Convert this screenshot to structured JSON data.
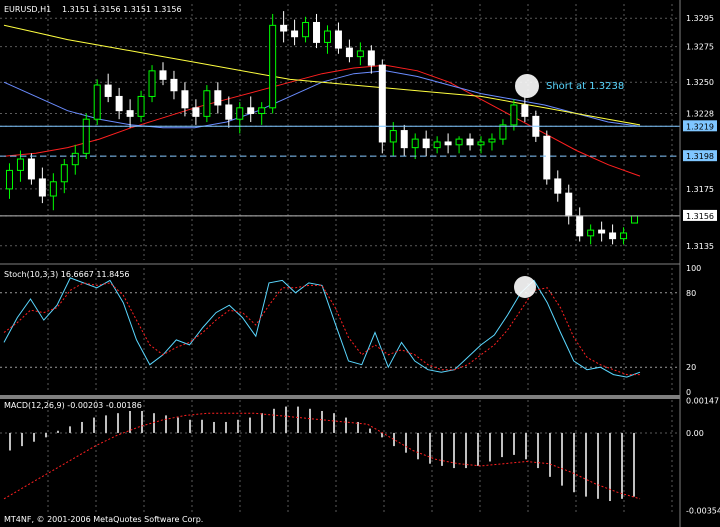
{
  "header": {
    "symbol": "EURUSD,H1",
    "ohlc": "1.3151 1.3156 1.3151 1.3156"
  },
  "annotation": {
    "text": "Short at 1.3238"
  },
  "stoch_header": "Stoch(10,3,3) 16.6667 11.8456",
  "macd_header": "MACD(12,26,9) -0.00203 -0.00186",
  "footer": "MT4NF, © 2001-2006 MetaQuotes Software Corp.",
  "colors": {
    "background": "#000000",
    "bull_candle": "#00ff00",
    "bear_candle": "#ffffff",
    "ma_fast": "#ff2020",
    "ma_mid": "#6a8cff",
    "ma_slow": "#ffff40",
    "stoch_main": "#5ad7ff",
    "stoch_signal": "#ff2020",
    "macd_hist": "#c0c0c0",
    "macd_signal": "#ff2020",
    "h_line_1": "#7fc6ff",
    "h_line_2": "#7fc6ff",
    "highlight": "#ffffff",
    "annotation_text": "#5ad7ff"
  },
  "chart_data": [
    {
      "type": "candlestick",
      "symbol": "EURUSD",
      "timeframe": "H1",
      "ylim": [
        1.3125,
        1.3305
      ],
      "y_ticks": [
        "1.3295",
        "1.3275",
        "1.3250",
        "1.3228",
        "1.3219",
        "1.3198",
        "1.3175",
        "1.3156",
        "1.3135"
      ],
      "highlighted_price_labels": [
        "1.3219",
        "1.3198",
        "1.3156"
      ],
      "h_lines": [
        1.3219,
        1.3198,
        1.3156
      ],
      "candles": [
        [
          1.3175,
          1.3193,
          1.3168,
          1.3188
        ],
        [
          1.3188,
          1.3202,
          1.318,
          1.3196
        ],
        [
          1.3196,
          1.32,
          1.3178,
          1.3182
        ],
        [
          1.3182,
          1.319,
          1.3165,
          1.317
        ],
        [
          1.317,
          1.3186,
          1.316,
          1.318
        ],
        [
          1.318,
          1.3196,
          1.3172,
          1.3192
        ],
        [
          1.3192,
          1.3206,
          1.3185,
          1.32
        ],
        [
          1.32,
          1.3228,
          1.3196,
          1.3224
        ],
        [
          1.3224,
          1.3252,
          1.322,
          1.3248
        ],
        [
          1.3248,
          1.3256,
          1.3236,
          1.324
        ],
        [
          1.324,
          1.3246,
          1.3224,
          1.323
        ],
        [
          1.323,
          1.3238,
          1.3218,
          1.3226
        ],
        [
          1.3226,
          1.3244,
          1.3222,
          1.324
        ],
        [
          1.324,
          1.3262,
          1.3236,
          1.3258
        ],
        [
          1.3258,
          1.3264,
          1.3248,
          1.3252
        ],
        [
          1.3252,
          1.3258,
          1.3238,
          1.3244
        ],
        [
          1.3244,
          1.325,
          1.3226,
          1.3232
        ],
        [
          1.3232,
          1.3238,
          1.322,
          1.3226
        ],
        [
          1.3226,
          1.3248,
          1.3222,
          1.3244
        ],
        [
          1.3244,
          1.325,
          1.3228,
          1.3234
        ],
        [
          1.3234,
          1.324,
          1.3218,
          1.3224
        ],
        [
          1.3224,
          1.3236,
          1.3214,
          1.3232
        ],
        [
          1.3232,
          1.324,
          1.3222,
          1.3228
        ],
        [
          1.3228,
          1.3236,
          1.322,
          1.3232
        ],
        [
          1.3232,
          1.3298,
          1.3228,
          1.329
        ],
        [
          1.329,
          1.33,
          1.3278,
          1.3286
        ],
        [
          1.3286,
          1.3294,
          1.3276,
          1.3282
        ],
        [
          1.3282,
          1.3296,
          1.3278,
          1.3292
        ],
        [
          1.3292,
          1.3298,
          1.3274,
          1.3278
        ],
        [
          1.3278,
          1.329,
          1.327,
          1.3286
        ],
        [
          1.3286,
          1.3292,
          1.327,
          1.3274
        ],
        [
          1.3274,
          1.328,
          1.3264,
          1.3268
        ],
        [
          1.3268,
          1.3278,
          1.3262,
          1.3272
        ],
        [
          1.3272,
          1.3276,
          1.3256,
          1.3262
        ],
        [
          1.3262,
          1.3266,
          1.32,
          1.3208
        ],
        [
          1.3208,
          1.3222,
          1.3198,
          1.3216
        ],
        [
          1.3216,
          1.322,
          1.3198,
          1.3204
        ],
        [
          1.3204,
          1.3214,
          1.3196,
          1.321
        ],
        [
          1.321,
          1.3216,
          1.3198,
          1.3204
        ],
        [
          1.3204,
          1.3212,
          1.32,
          1.3208
        ],
        [
          1.3208,
          1.3214,
          1.32,
          1.3206
        ],
        [
          1.3206,
          1.3212,
          1.32,
          1.321
        ],
        [
          1.321,
          1.3214,
          1.3202,
          1.3206
        ],
        [
          1.3206,
          1.3212,
          1.32,
          1.3208
        ],
        [
          1.3208,
          1.3214,
          1.3202,
          1.321
        ],
        [
          1.321,
          1.3224,
          1.3206,
          1.322
        ],
        [
          1.322,
          1.3238,
          1.3216,
          1.3234
        ],
        [
          1.3234,
          1.324,
          1.3222,
          1.3226
        ],
        [
          1.3226,
          1.323,
          1.3208,
          1.3212
        ],
        [
          1.3212,
          1.3216,
          1.3178,
          1.3182
        ],
        [
          1.3182,
          1.3188,
          1.3166,
          1.3172
        ],
        [
          1.3172,
          1.3178,
          1.315,
          1.3156
        ],
        [
          1.3156,
          1.3162,
          1.3138,
          1.3142
        ],
        [
          1.3142,
          1.315,
          1.3136,
          1.3146
        ],
        [
          1.3146,
          1.3152,
          1.3138,
          1.3144
        ],
        [
          1.3144,
          1.315,
          1.3136,
          1.314
        ],
        [
          1.314,
          1.3148,
          1.3136,
          1.3144
        ],
        [
          1.3151,
          1.3156,
          1.3151,
          1.3156
        ]
      ],
      "ma_series": [
        {
          "values": [
            1.3198,
            1.32,
            1.3204,
            1.321,
            1.3218,
            1.3225,
            1.3232,
            1.3238,
            1.3244,
            1.325,
            1.3256,
            1.326,
            1.3262,
            1.3258,
            1.325,
            1.3238,
            1.3226,
            1.3214,
            1.3202,
            1.3192,
            1.3184
          ]
        },
        {
          "values": [
            1.325,
            1.324,
            1.323,
            1.3224,
            1.322,
            1.3218,
            1.3218,
            1.3222,
            1.323,
            1.324,
            1.325,
            1.3256,
            1.3258,
            1.3254,
            1.3248,
            1.3242,
            1.3238,
            1.3234,
            1.3228,
            1.3222,
            1.3219
          ]
        },
        {
          "values": [
            1.329,
            1.3285,
            1.328,
            1.3276,
            1.3272,
            1.3268,
            1.3264,
            1.326,
            1.3256,
            1.3252,
            1.325,
            1.3248,
            1.3246,
            1.3244,
            1.3242,
            1.324,
            1.3236,
            1.3232,
            1.3228,
            1.3224,
            1.322
          ]
        }
      ]
    },
    {
      "type": "line",
      "name": "Stoch(10,3,3)",
      "ylim": [
        0,
        100
      ],
      "y_ticks": [
        "100",
        "80",
        "20",
        "0"
      ],
      "series": [
        {
          "values": [
            40,
            60,
            75,
            58,
            70,
            92,
            88,
            84,
            90,
            72,
            42,
            22,
            30,
            42,
            38,
            52,
            64,
            70,
            60,
            45,
            88,
            90,
            80,
            88,
            86,
            55,
            25,
            22,
            48,
            20,
            40,
            25,
            18,
            16,
            18,
            28,
            38,
            46,
            62,
            80,
            90,
            72,
            48,
            25,
            18,
            20,
            14,
            12,
            16
          ]
        },
        {
          "values": [
            48,
            56,
            66,
            64,
            68,
            82,
            88,
            86,
            88,
            78,
            58,
            38,
            30,
            36,
            40,
            48,
            58,
            66,
            64,
            54,
            70,
            84,
            84,
            86,
            86,
            68,
            44,
            30,
            38,
            30,
            34,
            30,
            22,
            18,
            18,
            22,
            30,
            38,
            50,
            66,
            82,
            84,
            68,
            44,
            28,
            22,
            18,
            14,
            14
          ]
        }
      ]
    },
    {
      "type": "bar",
      "name": "MACD(12,26,9)",
      "ylim": [
        -0.0036,
        0.0015
      ],
      "y_ticks": [
        "0.00147",
        "0.00",
        "-0.00354"
      ],
      "histogram": [
        -0.0008,
        -0.0006,
        -0.0004,
        -0.0002,
        0.0001,
        0.0003,
        0.0005,
        0.0007,
        0.0008,
        0.0009,
        0.001,
        0.001,
        0.0009,
        0.0008,
        0.0007,
        0.0006,
        0.0006,
        0.0005,
        0.0005,
        0.0006,
        0.0007,
        0.0009,
        0.0011,
        0.0012,
        0.0012,
        0.0011,
        0.001,
        0.0009,
        0.0007,
        0.0005,
        0.0002,
        -0.0002,
        -0.0006,
        -0.0009,
        -0.0012,
        -0.0014,
        -0.0015,
        -0.0016,
        -0.0016,
        -0.0015,
        -0.0013,
        -0.0011,
        -0.001,
        -0.0012,
        -0.0016,
        -0.002,
        -0.0024,
        -0.0027,
        -0.0029,
        -0.003,
        -0.0031,
        -0.003,
        -0.0029
      ],
      "signal": [
        -0.003,
        -0.0024,
        -0.0018,
        -0.0012,
        -0.0006,
        -0.0001,
        0.0003,
        0.0006,
        0.0008,
        0.0009,
        0.0009,
        0.0009,
        0.0008,
        0.0007,
        0.0006,
        0.0005,
        0.0004,
        -0.0002,
        -0.0008,
        -0.0012,
        -0.0014,
        -0.0015,
        -0.0014,
        -0.0013,
        -0.0014,
        -0.0018,
        -0.0023,
        -0.0027,
        -0.003
      ]
    }
  ]
}
